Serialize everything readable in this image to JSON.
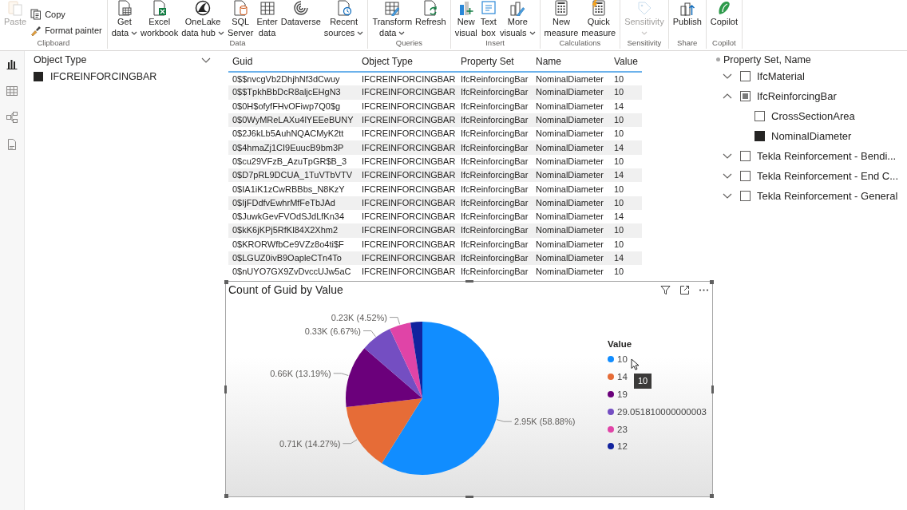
{
  "ribbon": {
    "groups": [
      {
        "label": "Clipboard",
        "items": [
          {
            "kind": "large",
            "lines": [
              "Paste"
            ],
            "disabled": true,
            "dropdown": false
          },
          {
            "kind": "small",
            "lines": [
              "Copy"
            ],
            "disabled": false,
            "dropdown": false
          },
          {
            "kind": "small",
            "lines": [
              "Format painter"
            ],
            "disabled": false,
            "dropdown": false
          }
        ]
      },
      {
        "label": "Data",
        "items": [
          {
            "kind": "large",
            "lines": [
              "Get",
              "data"
            ],
            "disabled": false,
            "dropdown": true
          },
          {
            "kind": "large",
            "lines": [
              "Excel",
              "workbook"
            ],
            "disabled": false,
            "dropdown": false
          },
          {
            "kind": "large",
            "lines": [
              "OneLake",
              "data hub"
            ],
            "disabled": false,
            "dropdown": true
          },
          {
            "kind": "large",
            "lines": [
              "SQL",
              "Server"
            ],
            "disabled": false,
            "dropdown": false
          },
          {
            "kind": "large",
            "lines": [
              "Enter",
              "data"
            ],
            "disabled": false,
            "dropdown": false
          },
          {
            "kind": "large",
            "lines": [
              "Dataverse"
            ],
            "disabled": false,
            "dropdown": false
          },
          {
            "kind": "large",
            "lines": [
              "Recent",
              "sources"
            ],
            "disabled": false,
            "dropdown": true
          }
        ]
      },
      {
        "label": "Queries",
        "items": [
          {
            "kind": "large",
            "lines": [
              "Transform",
              "data"
            ],
            "disabled": false,
            "dropdown": true
          },
          {
            "kind": "large",
            "lines": [
              "Refresh"
            ],
            "disabled": false,
            "dropdown": false
          }
        ]
      },
      {
        "label": "Insert",
        "items": [
          {
            "kind": "large",
            "lines": [
              "New",
              "visual"
            ],
            "disabled": false,
            "dropdown": false
          },
          {
            "kind": "large",
            "lines": [
              "Text",
              "box"
            ],
            "disabled": false,
            "dropdown": false
          },
          {
            "kind": "large",
            "lines": [
              "More",
              "visuals"
            ],
            "disabled": false,
            "dropdown": true
          }
        ]
      },
      {
        "label": "Calculations",
        "items": [
          {
            "kind": "large",
            "lines": [
              "New",
              "measure"
            ],
            "disabled": false,
            "dropdown": false
          },
          {
            "kind": "large",
            "lines": [
              "Quick",
              "measure"
            ],
            "disabled": false,
            "dropdown": false
          }
        ]
      },
      {
        "label": "Sensitivity",
        "items": [
          {
            "kind": "large",
            "lines": [
              "Sensitivity"
            ],
            "disabled": true,
            "dropdown": true
          }
        ]
      },
      {
        "label": "Share",
        "items": [
          {
            "kind": "large",
            "lines": [
              "Publish"
            ],
            "disabled": false,
            "dropdown": false
          }
        ]
      },
      {
        "label": "Copilot",
        "items": [
          {
            "kind": "large",
            "lines": [
              "Copilot"
            ],
            "disabled": false,
            "dropdown": false
          }
        ]
      }
    ]
  },
  "nav": {
    "items": [
      {
        "selected": true
      },
      {
        "selected": false
      },
      {
        "selected": false
      },
      {
        "selected": false
      }
    ]
  },
  "object_slicer": {
    "title": "Object Type",
    "items": [
      {
        "label": "IFCREINFORCINGBAR",
        "checked": true
      }
    ]
  },
  "table": {
    "columns": [
      "Guid",
      "Object Type",
      "Property Set",
      "Name",
      "Value"
    ],
    "rows": [
      [
        "0$$nvcgVb2DhjhNf3dCwuy",
        "IFCREINFORCINGBAR",
        "IfcReinforcingBar",
        "NominalDiameter",
        "10"
      ],
      [
        "0$$TpkhBbDcR8aljcEHgN3",
        "IFCREINFORCINGBAR",
        "IfcReinforcingBar",
        "NominalDiameter",
        "10"
      ],
      [
        "0$0H$ofyfFHvOFiwp7Q0$g",
        "IFCREINFORCINGBAR",
        "IfcReinforcingBar",
        "NominalDiameter",
        "14"
      ],
      [
        "0$0WyMReLAXu4lYEEeBUNY",
        "IFCREINFORCINGBAR",
        "IfcReinforcingBar",
        "NominalDiameter",
        "10"
      ],
      [
        "0$2J6kLb5AuhNQACMyK2tt",
        "IFCREINFORCINGBAR",
        "IfcReinforcingBar",
        "NominalDiameter",
        "10"
      ],
      [
        "0$4hmaZj1CI9EuucB9bm3P",
        "IFCREINFORCINGBAR",
        "IfcReinforcingBar",
        "NominalDiameter",
        "14"
      ],
      [
        "0$cu29VFzB_AzuTpGR$B_3",
        "IFCREINFORCINGBAR",
        "IfcReinforcingBar",
        "NominalDiameter",
        "10"
      ],
      [
        "0$D7pRL9DCUA_1TuVTbVTV",
        "IFCREINFORCINGBAR",
        "IfcReinforcingBar",
        "NominalDiameter",
        "14"
      ],
      [
        "0$IA1iK1zCwRBBbs_N8KzY",
        "IFCREINFORCINGBAR",
        "IfcReinforcingBar",
        "NominalDiameter",
        "10"
      ],
      [
        "0$IjFDdfvEwhrMfFeTbJAd",
        "IFCREINFORCINGBAR",
        "IfcReinforcingBar",
        "NominalDiameter",
        "10"
      ],
      [
        "0$JuwkGevFVOdSJdLfKn34",
        "IFCREINFORCINGBAR",
        "IfcReinforcingBar",
        "NominalDiameter",
        "14"
      ],
      [
        "0$kK6jKPj5RfKl84X2Xhm2",
        "IFCREINFORCINGBAR",
        "IfcReinforcingBar",
        "NominalDiameter",
        "10"
      ],
      [
        "0$KRORWfbCe9VZz8o4ti$F",
        "IFCREINFORCINGBAR",
        "IfcReinforcingBar",
        "NominalDiameter",
        "10"
      ],
      [
        "0$LGUZ0ivB9OapleCTn4To",
        "IFCREINFORCINGBAR",
        "IfcReinforcingBar",
        "NominalDiameter",
        "14"
      ],
      [
        "0$nUYO7GX9ZvDvccUJw5aC",
        "IFCREINFORCINGBAR",
        "IfcReinforcingBar",
        "NominalDiameter",
        "10"
      ]
    ]
  },
  "pie_visual": {
    "legend": {
      "title": "Value",
      "items": [
        {
          "color": "#118dff"
        },
        {
          "color": "#e66c37"
        },
        {
          "color": "#6b007b"
        },
        {
          "color": "#744ec2"
        },
        {
          "color": "#e044a7"
        },
        {
          "color": "#12239e"
        }
      ]
    },
    "tooltip": "10",
    "chart_data": {
      "type": "pie",
      "title": "Count of Guid by Value",
      "categories": [
        "10",
        "14",
        "19",
        "29.051810000000003",
        "23",
        "12"
      ],
      "values": [
        2950,
        715,
        661,
        334,
        226,
        124
      ],
      "value_labels": [
        "2.95K (58.88%)",
        "0.71K (14.27%)",
        "0.66K (13.19%)",
        "0.33K (6.67%)",
        "0.23K (4.52%)",
        null
      ]
    }
  },
  "property_slicer": {
    "title": "Property Set, Name",
    "items": [
      {
        "label": "IfcMaterial",
        "expanded": false,
        "checked": false,
        "partial": false
      },
      {
        "label": "IfcReinforcingBar",
        "expanded": true,
        "checked": false,
        "partial": true,
        "children": [
          {
            "label": "CrossSectionArea",
            "checked": false,
            "partial": false
          },
          {
            "label": "NominalDiameter",
            "checked": true,
            "partial": false
          }
        ]
      },
      {
        "label": "Tekla Reinforcement - Bendi...",
        "expanded": false,
        "checked": false,
        "partial": false
      },
      {
        "label": "Tekla Reinforcement - End C...",
        "expanded": false,
        "checked": false,
        "partial": false
      },
      {
        "label": "Tekla Reinforcement - General",
        "expanded": false,
        "checked": false,
        "partial": false
      }
    ]
  }
}
